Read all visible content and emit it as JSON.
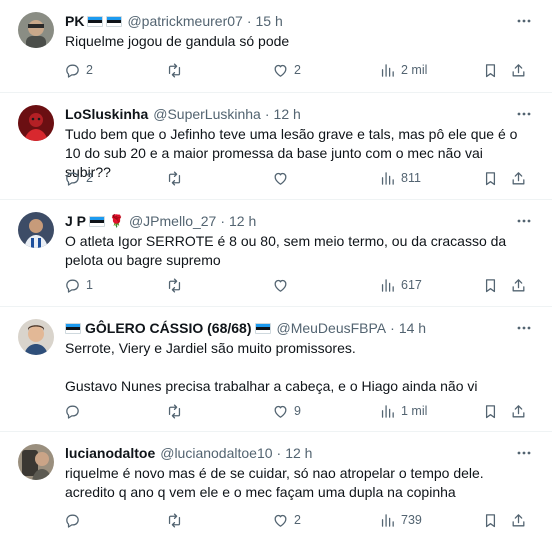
{
  "tweets": [
    {
      "name": "PK",
      "handle": "@patrickmeurer07",
      "time": "15 h",
      "text": "Riquelme jogou de gandula só pode",
      "replies": "2",
      "retweets": "",
      "likes": "2",
      "views": "2 mil"
    },
    {
      "name": "LoSluskinha",
      "handle": "@SuperLuskinha",
      "time": "12 h",
      "text": "Tudo bem que o Jefinho teve uma lesão grave e tals, mas pô ele que é o 10 do sub 20 e a maior promessa da base junto com o mec não vai subir??",
      "replies": "2",
      "retweets": "",
      "likes": "",
      "views": "811"
    },
    {
      "name": "J P",
      "handle": "@JPmello_27",
      "time": "12 h",
      "text": "O atleta Igor SERROTE é 8 ou 80, sem meio termo, ou da cracasso da pelota ou bagre supremo",
      "replies": "1",
      "retweets": "",
      "likes": "",
      "views": "617"
    },
    {
      "name": "GÔLERO CÁSSIO (68/68)",
      "handle": "@MeuDeusFBPA",
      "time": "14 h",
      "text": "Serrote, Viery e Jardiel são muito promissores.\n\nGustavo Nunes precisa trabalhar a cabeça, e o Hiago ainda não vi",
      "replies": "",
      "retweets": "",
      "likes": "9",
      "views": "1 mil"
    },
    {
      "name": "lucianodaltoe",
      "handle": "@lucianodaltoe10",
      "time": "12 h",
      "text": "riquelme é novo mas é de se cuidar, só nao atropelar o tempo dele.\nacredito q ano q vem ele e o mec façam uma dupla na copinha",
      "replies": "",
      "retweets": "",
      "likes": "2",
      "views": "739"
    }
  ],
  "separator": "·",
  "icons": {
    "more": "more-dots-icon",
    "reply": "reply-bubble-icon",
    "retweet": "retweet-arrows-icon",
    "like": "heart-icon",
    "views": "analytics-bars-icon",
    "bookmark": "bookmark-icon",
    "share": "share-upload-icon"
  },
  "colors": {
    "text": "#0f1419",
    "secondary": "#536471",
    "divider": "#eff3f4"
  }
}
